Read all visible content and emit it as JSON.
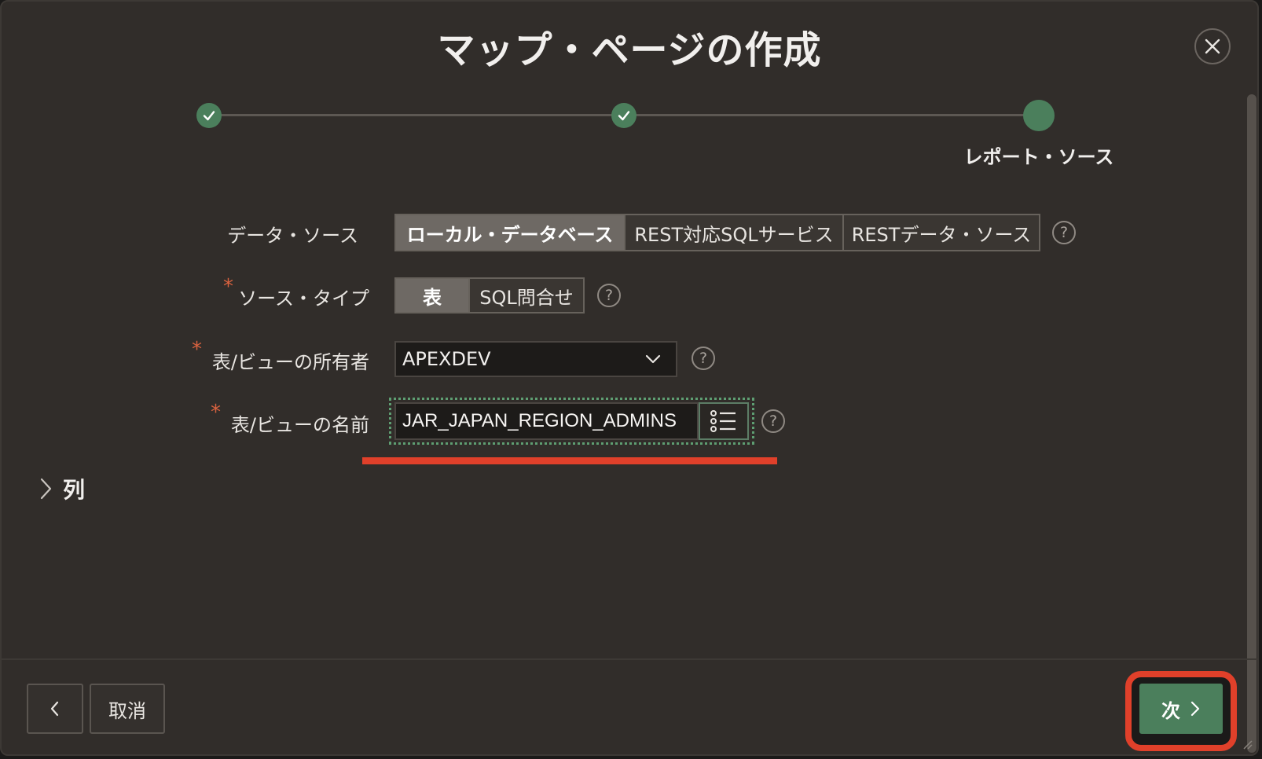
{
  "dialog": {
    "title": "マップ・ページの作成",
    "close_icon": "close-icon"
  },
  "wizard": {
    "steps": [
      {
        "status": "complete",
        "label": ""
      },
      {
        "status": "complete",
        "label": ""
      },
      {
        "status": "current",
        "label": "レポート・ソース"
      }
    ]
  },
  "form": {
    "data_source": {
      "label": "データ・ソース",
      "options": [
        "ローカル・データベース",
        "REST対応SQLサービス",
        "RESTデータ・ソース"
      ],
      "selected": "ローカル・データベース"
    },
    "source_type": {
      "required_mark": "*",
      "label": "ソース・タイプ",
      "options": [
        "表",
        "SQL問合せ"
      ],
      "selected": "表"
    },
    "owner": {
      "required_mark": "*",
      "label": "表/ビューの所有者",
      "value": "APEXDEV"
    },
    "table_name": {
      "required_mark": "*",
      "label": "表/ビューの名前",
      "value": "JAR_JAPAN_REGION_ADMINS"
    },
    "help_glyph": "?"
  },
  "columns_section": {
    "label": "列"
  },
  "footer": {
    "cancel_label": "取消",
    "next_label": "次"
  },
  "colors": {
    "accent_green": "#4b7f5c",
    "highlight_red": "#e0402a",
    "dialog_bg": "#312d2a"
  }
}
